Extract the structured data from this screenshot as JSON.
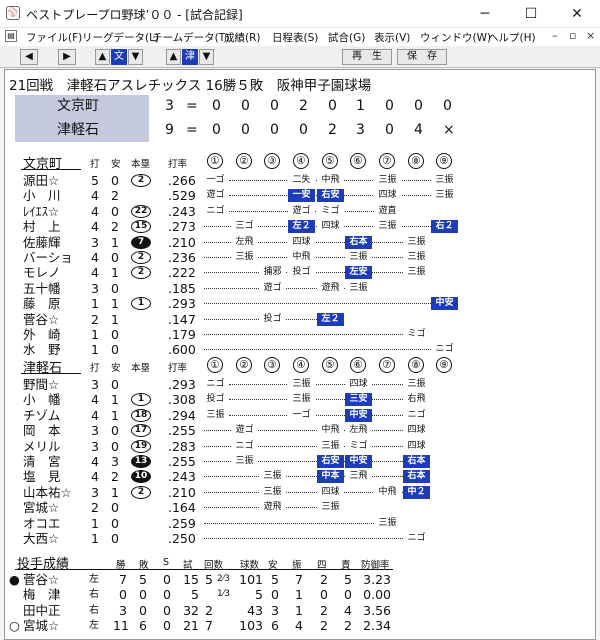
{
  "window": {
    "title": "ベストプレープロ野球’００ - [試合記録]",
    "minimize": "─",
    "maximize": "☐",
    "close": "✕",
    "icon": "⚾"
  },
  "menu": [
    {
      "label": "ファイル(F)"
    },
    {
      "label": "リーグデータ(L)"
    },
    {
      "label": "チームデータ(T)"
    },
    {
      "label": "成績(R)"
    },
    {
      "label": "日程表(S)"
    },
    {
      "label": "試合(G)"
    },
    {
      "label": "表示(V)"
    },
    {
      "label": "ウィンドウ(W)"
    },
    {
      "label": "ヘルプ(H)"
    }
  ],
  "mdi": {
    "minimize": "–",
    "restore": "▫",
    "close": "×"
  },
  "toolbar": {
    "prev": "◀",
    "next": "▶",
    "up1": "▲",
    "team1": "文",
    "down1": "▼",
    "up2": "▲",
    "team2": "津",
    "down2": "▼",
    "play": "再　生",
    "save": "保　存"
  },
  "game": {
    "header": "21回戦　津軽石アスレチックス 16勝５敗　阪神甲子園球場"
  },
  "scoreboard": [
    {
      "team": "文京町",
      "runs": "3",
      "eq": "=",
      "innings": [
        "0",
        "0",
        "0",
        "2",
        "0",
        "1",
        "0",
        "0",
        "0"
      ]
    },
    {
      "team": "津軽石",
      "runs": "9",
      "eq": "=",
      "innings": [
        "0",
        "0",
        "0",
        "0",
        "2",
        "3",
        "0",
        "4",
        "×"
      ]
    }
  ],
  "batting_headers": {
    "hits": "打",
    "ab": "安",
    "hr": "本塁",
    "avg": "打率",
    "innings": [
      "①",
      "②",
      "③",
      "④",
      "⑤",
      "⑥",
      "⑦",
      "⑧",
      "⑨"
    ]
  },
  "batting": [
    {
      "team": "文京町",
      "players": [
        {
          "name": "源田☆",
          "ab": "5",
          "h": "0",
          "hr": "2",
          "hrfill": false,
          "avg": ".266",
          "res": [
            "一ゴ",
            "",
            "",
            "二失",
            "中飛",
            "",
            "三振",
            "",
            "三振"
          ]
        },
        {
          "name": "小　川",
          "ab": "4",
          "h": "2",
          "hr": "",
          "hrfill": false,
          "avg": ".529",
          "res": [
            "遊ゴ",
            "",
            "",
            "一安",
            "右安",
            "",
            "四球",
            "",
            "三振"
          ]
        },
        {
          "name": "ﾚｲｴｽ☆",
          "ab": "4",
          "h": "0",
          "hr": "22",
          "hrfill": false,
          "avg": ".243",
          "res": [
            "ニゴ",
            "",
            "",
            "遊ゴ",
            "ミゴ",
            "",
            "遊直",
            "",
            ""
          ]
        },
        {
          "name": "村　上",
          "ab": "4",
          "h": "2",
          "hr": "15",
          "hrfill": false,
          "avg": ".273",
          "res": [
            "",
            "三ゴ",
            "",
            "左２",
            "四球",
            "",
            "三振",
            "",
            "右２"
          ]
        },
        {
          "name": "佐藤輝",
          "ab": "3",
          "h": "1",
          "hr": "7",
          "hrfill": true,
          "avg": ".210",
          "res": [
            "",
            "左飛",
            "",
            "四球",
            "",
            "右本",
            "",
            "三振",
            ""
          ]
        },
        {
          "name": "バーショ",
          "ab": "4",
          "h": "0",
          "hr": "2",
          "hrfill": false,
          "avg": ".236",
          "res": [
            "",
            "三振",
            "",
            "中飛",
            "",
            "三振",
            "",
            "三振",
            ""
          ]
        },
        {
          "name": "モレノ",
          "ab": "4",
          "h": "1",
          "hr": "2",
          "hrfill": false,
          "avg": ".222",
          "res": [
            "",
            "",
            "捕邪",
            "投ゴ",
            "",
            "左安",
            "",
            "三振",
            ""
          ]
        },
        {
          "name": "五十幡",
          "ab": "3",
          "h": "0",
          "hr": "",
          "hrfill": false,
          "avg": ".185",
          "res": [
            "",
            "",
            "遊ゴ",
            "",
            "遊飛",
            "三振",
            "",
            "",
            ""
          ]
        },
        {
          "name": "藤　原",
          "ab": "1",
          "h": "1",
          "hr": "1",
          "hrfill": false,
          "avg": ".293",
          "res": [
            "",
            "",
            "",
            "",
            "",
            "",
            "",
            "",
            "中安"
          ]
        },
        {
          "name": "菅谷☆",
          "ab": "2",
          "h": "1",
          "hr": "",
          "hrfill": false,
          "avg": ".147",
          "res": [
            "",
            "",
            "投ゴ",
            "",
            "左２",
            "",
            "",
            "",
            ""
          ]
        },
        {
          "name": "外　崎",
          "ab": "1",
          "h": "0",
          "hr": "",
          "hrfill": false,
          "avg": ".179",
          "res": [
            "",
            "",
            "",
            "",
            "",
            "",
            "",
            "ミゴ",
            ""
          ]
        },
        {
          "name": "水　野",
          "ab": "1",
          "h": "0",
          "hr": "",
          "hrfill": false,
          "avg": ".600",
          "res": [
            "",
            "",
            "",
            "",
            "",
            "",
            "",
            "",
            "ニゴ"
          ]
        }
      ]
    },
    {
      "team": "津軽石",
      "players": [
        {
          "name": "野間☆",
          "ab": "3",
          "h": "0",
          "hr": "",
          "hrfill": false,
          "avg": ".293",
          "res": [
            "ニゴ",
            "",
            "",
            "三振",
            "",
            "四球",
            "",
            "三振",
            ""
          ]
        },
        {
          "name": "小　幡",
          "ab": "4",
          "h": "1",
          "hr": "1",
          "hrfill": false,
          "avg": ".308",
          "res": [
            "投ゴ",
            "",
            "",
            "三振",
            "",
            "三安",
            "",
            "右飛",
            ""
          ]
        },
        {
          "name": "チゾム",
          "ab": "4",
          "h": "1",
          "hr": "18",
          "hrfill": false,
          "avg": ".294",
          "res": [
            "三振",
            "",
            "",
            "一ゴ",
            "",
            "中安",
            "",
            "ニゴ",
            ""
          ]
        },
        {
          "name": "岡　本",
          "ab": "3",
          "h": "0",
          "hr": "17",
          "hrfill": false,
          "avg": ".255",
          "res": [
            "",
            "遊ゴ",
            "",
            "",
            "中飛",
            "左飛",
            "",
            "四球",
            ""
          ]
        },
        {
          "name": "メリル",
          "ab": "3",
          "h": "0",
          "hr": "19",
          "hrfill": false,
          "avg": ".283",
          "res": [
            "",
            "ニゴ",
            "",
            "",
            "三振",
            "ミゴ",
            "",
            "四球",
            ""
          ]
        },
        {
          "name": "清　宮",
          "ab": "4",
          "h": "3",
          "hr": "13",
          "hrfill": true,
          "avg": ".255",
          "res": [
            "",
            "三振",
            "",
            "",
            "右安",
            "中安",
            "",
            "右本",
            ""
          ]
        },
        {
          "name": "塩　見",
          "ab": "4",
          "h": "2",
          "hr": "10",
          "hrfill": true,
          "avg": ".243",
          "res": [
            "",
            "",
            "三振",
            "",
            "中本",
            "三飛",
            "",
            "右本",
            ""
          ]
        },
        {
          "name": "山本祐☆",
          "ab": "3",
          "h": "1",
          "hr": "2",
          "hrfill": false,
          "avg": ".210",
          "res": [
            "",
            "",
            "三振",
            "",
            "四球",
            "",
            "中飛",
            "中２",
            ""
          ]
        },
        {
          "name": "宮城☆",
          "ab": "2",
          "h": "0",
          "hr": "",
          "hrfill": false,
          "avg": ".164",
          "res": [
            "",
            "",
            "遊飛",
            "",
            "三振",
            "",
            "",
            "",
            ""
          ]
        },
        {
          "name": "オコエ",
          "ab": "1",
          "h": "0",
          "hr": "",
          "hrfill": false,
          "avg": ".259",
          "res": [
            "",
            "",
            "",
            "",
            "",
            "",
            "三振",
            "",
            ""
          ]
        },
        {
          "name": "大西☆",
          "ab": "1",
          "h": "0",
          "hr": "",
          "hrfill": false,
          "avg": ".250",
          "res": [
            "",
            "",
            "",
            "",
            "",
            "",
            "",
            "ニゴ",
            ""
          ]
        }
      ]
    }
  ],
  "pitching": {
    "title": "投手成績",
    "headers": {
      "w": "勝",
      "l": "敗",
      "s": "S",
      "g": "試",
      "ip": "回数",
      "bf": "球数",
      "h": "安",
      "k": "振",
      "bb": "四",
      "er": "責",
      "era": "防御率"
    },
    "rows": [
      {
        "mark": "●",
        "name": "菅谷☆",
        "hand": "左",
        "w": "7",
        "l": "5",
        "s": "0",
        "g": "15",
        "ip": "5",
        "ipf": "2⁄3",
        "bf": "101",
        "h": "5",
        "k": "7",
        "bb": "2",
        "er": "5",
        "era": "3.23"
      },
      {
        "mark": "",
        "name": "梅　津",
        "hand": "右",
        "w": "0",
        "l": "0",
        "s": "0",
        "g": "5",
        "ip": "",
        "ipf": "1⁄3",
        "bf": "5",
        "h": "0",
        "k": "1",
        "bb": "0",
        "er": "0",
        "era": "0.00"
      },
      {
        "mark": "",
        "name": "田中正",
        "hand": "右",
        "w": "3",
        "l": "0",
        "s": "0",
        "g": "32",
        "ip": "2",
        "ipf": "",
        "bf": "43",
        "h": "3",
        "k": "1",
        "bb": "2",
        "er": "4",
        "era": "3.56"
      },
      {
        "mark": "○",
        "name": "宮城☆",
        "hand": "左",
        "w": "11",
        "l": "6",
        "s": "0",
        "g": "21",
        "ip": "7",
        "ipf": "",
        "bf": "103",
        "h": "6",
        "k": "4",
        "bb": "2",
        "er": "2",
        "era": "2.34"
      }
    ]
  },
  "colors": {
    "hit": "#1d3db8",
    "scorebox": "#c4c9dd"
  }
}
